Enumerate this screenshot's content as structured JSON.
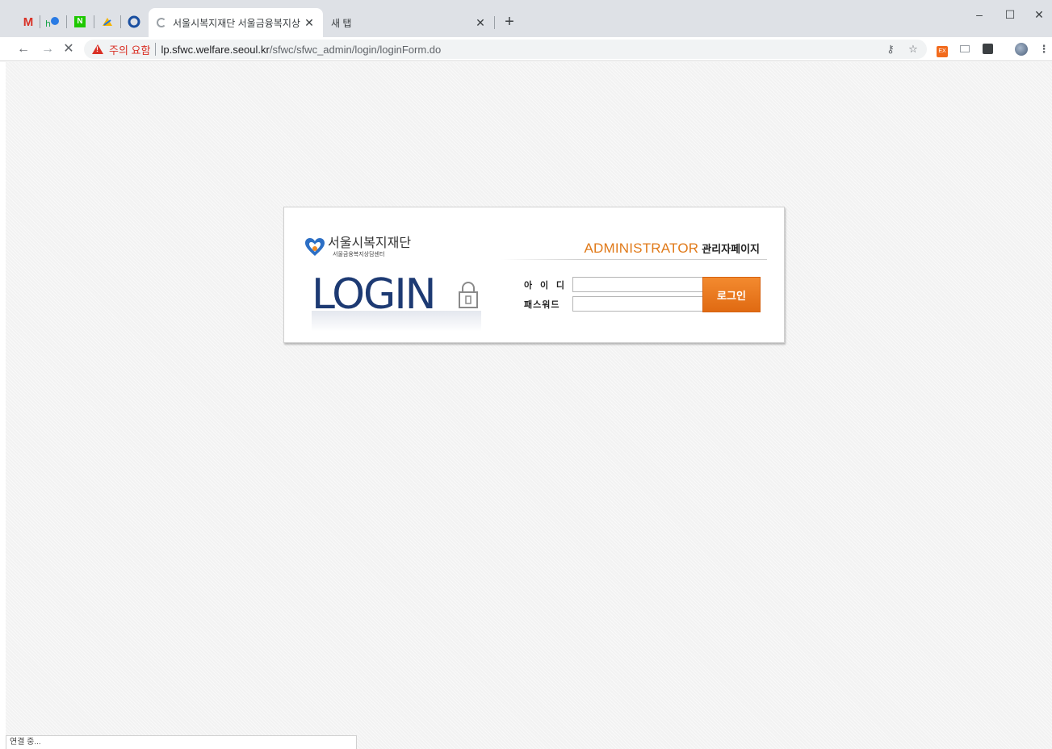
{
  "tabs": [
    {
      "title": "서울시복지재단 서울금융복지상",
      "loading": true,
      "active": true
    },
    {
      "title": "새 탭",
      "active": false
    }
  ],
  "address_bar": {
    "security_warning": "주의 요함",
    "url_host": "lp.sfwc.welfare.seoul.kr",
    "url_path": "/sfwc/sfwc_admin/login/loginForm.do"
  },
  "extensions": [
    "EX"
  ],
  "login": {
    "org_name": "서울시복지재단",
    "org_sub": "서울금융복지상담센터",
    "logo_text": "LOGIN",
    "admin_en": "ADMINISTRATOR",
    "admin_ko": "관리자페이지",
    "id_label": "아 이 디",
    "pw_label": "패스워드",
    "id_value": "",
    "pw_value": "",
    "button_label": "로그인"
  },
  "status": "연결 중...",
  "colors": {
    "accent_orange": "#e07a1a",
    "login_blue": "#1d3a73",
    "warning_red": "#d93025"
  }
}
